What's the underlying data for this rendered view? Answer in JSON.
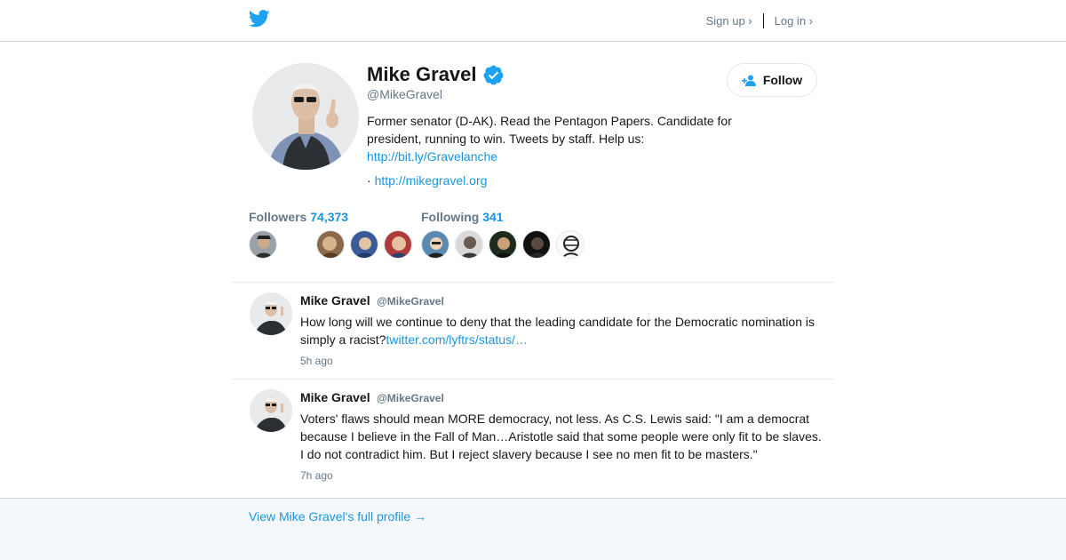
{
  "header": {
    "logo": "twitter-bird-icon",
    "signup_label": "Sign up ›",
    "login_label": "Log in ›"
  },
  "profile": {
    "name": "Mike Gravel",
    "handle": "@MikeGravel",
    "verified_icon": "verified-badge-icon",
    "bio_text": "Former senator (D-AK). Read the Pentagon Papers. Candidate for president, running to win. Tweets by staff. Help us:",
    "bio_link": "http://bit.ly/Gravelanche",
    "website_prefix": "·",
    "website": "http://mikegravel.org",
    "follow_label": "Follow"
  },
  "stats": {
    "followers_label": "Followers",
    "followers_count": "74,373",
    "following_label": "Following",
    "following_count": "341"
  },
  "tweets": [
    {
      "name": "Mike Gravel",
      "handle": "@MikeGravel",
      "text": "How long will we continue to deny that the leading candidate for the Democratic nomination is simply a racist?",
      "link": "twitter.com/lyftrs/status/…",
      "time": "5h ago"
    },
    {
      "name": "Mike Gravel",
      "handle": "@MikeGravel",
      "text": "Voters' flaws should mean MORE democracy, not less. As C.S. Lewis said: \"I am a democrat because I believe in the Fall of Man…Aristotle said that some people were only fit to be slaves. I do not contradict him. But I reject slavery because I see no men fit to be masters.\"",
      "time": "7h ago"
    }
  ],
  "footer": {
    "full_profile_link": "View Mike Gravel's full profile →"
  },
  "colors": {
    "accent": "#1b95e0",
    "text": "#14171a",
    "muted": "#657786",
    "footer_bg": "#f5f8fa"
  }
}
